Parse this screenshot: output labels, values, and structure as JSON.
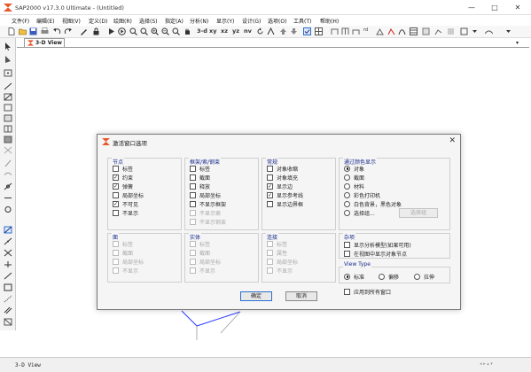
{
  "window": {
    "title": "SAP2000 v17.3.0 Ultimate - (Untitled)",
    "minimize": "—",
    "maximize": "□",
    "close": "✕"
  },
  "menu": [
    "文件(F)",
    "编辑(E)",
    "视图(V)",
    "定义(D)",
    "绘图(R)",
    "选择(S)",
    "指定(A)",
    "分析(N)",
    "显示(Y)",
    "设计(G)",
    "选项(O)",
    "工具(T)",
    "帮助(H)"
  ],
  "toolbar": {
    "view_labels": [
      "3-d",
      "xy",
      "xz",
      "yz",
      "nv"
    ],
    "rd_label": "rd"
  },
  "view_tab": {
    "label": "3-D View"
  },
  "statusbar": {
    "left": "3-D View"
  },
  "dialog": {
    "title": "激活窗口选项",
    "close": "✕",
    "nodes": {
      "title": "节点",
      "items": [
        {
          "label": "标签",
          "checked": false
        },
        {
          "label": "约束",
          "checked": true
        },
        {
          "label": "弹簧",
          "checked": true
        },
        {
          "label": "局部坐标",
          "checked": false
        },
        {
          "label": "不可见",
          "checked": true
        },
        {
          "label": "不显示",
          "checked": false
        }
      ]
    },
    "frames": {
      "title": "框架/索/钢束",
      "items": [
        {
          "label": "标签",
          "checked": false,
          "enabled": true
        },
        {
          "label": "截面",
          "checked": false,
          "enabled": true
        },
        {
          "label": "释放",
          "checked": false,
          "enabled": true
        },
        {
          "label": "局部坐标",
          "checked": false,
          "enabled": true
        },
        {
          "label": "不显示框架",
          "checked": false,
          "enabled": true
        },
        {
          "label": "不显示索",
          "checked": false,
          "enabled": false
        },
        {
          "label": "不显示钢束",
          "checked": false,
          "enabled": false
        }
      ]
    },
    "general": {
      "title": "常规",
      "items": [
        {
          "label": "对象收缩",
          "checked": false
        },
        {
          "label": "对象填充",
          "checked": false
        },
        {
          "label": "显示边",
          "checked": true
        },
        {
          "label": "显示参考线",
          "checked": true
        },
        {
          "label": "显示边界框",
          "checked": false
        }
      ]
    },
    "color": {
      "title": "通过颜色显示",
      "items": [
        {
          "label": "对象",
          "selected": true
        },
        {
          "label": "截面",
          "selected": false
        },
        {
          "label": "材料",
          "selected": false
        },
        {
          "label": "彩色打印机",
          "selected": false
        },
        {
          "label": "白色背景，黑色对象",
          "selected": false
        },
        {
          "label": "选择组...",
          "selected": false
        }
      ],
      "select_group_btn": "选择组"
    },
    "areas": {
      "title": "面",
      "items": [
        "标签",
        "截面",
        "局部坐标",
        "不显示"
      ]
    },
    "solids": {
      "title": "实体",
      "items": [
        "标签",
        "截面",
        "局部坐标",
        "不显示"
      ]
    },
    "links": {
      "title": "连接",
      "items": [
        "标签",
        "属性",
        "局部坐标",
        "不显示"
      ]
    },
    "misc": {
      "title": "杂项",
      "items": [
        {
          "label": "显示分析模型(如果可用)",
          "checked": false
        },
        {
          "label": "在视图中显示对象节点",
          "checked": false
        }
      ]
    },
    "viewtype": {
      "title": "View Type",
      "items": [
        {
          "label": "标准",
          "selected": true
        },
        {
          "label": "偏移",
          "selected": false
        },
        {
          "label": "拉伸",
          "selected": false
        }
      ]
    },
    "apply_all": "应用到所有窗口",
    "ok": "确定",
    "cancel": "取消"
  },
  "colors": {
    "accent": "#1a2b8c",
    "primary_border": "#2b6fce",
    "logo": "#e8562a"
  }
}
